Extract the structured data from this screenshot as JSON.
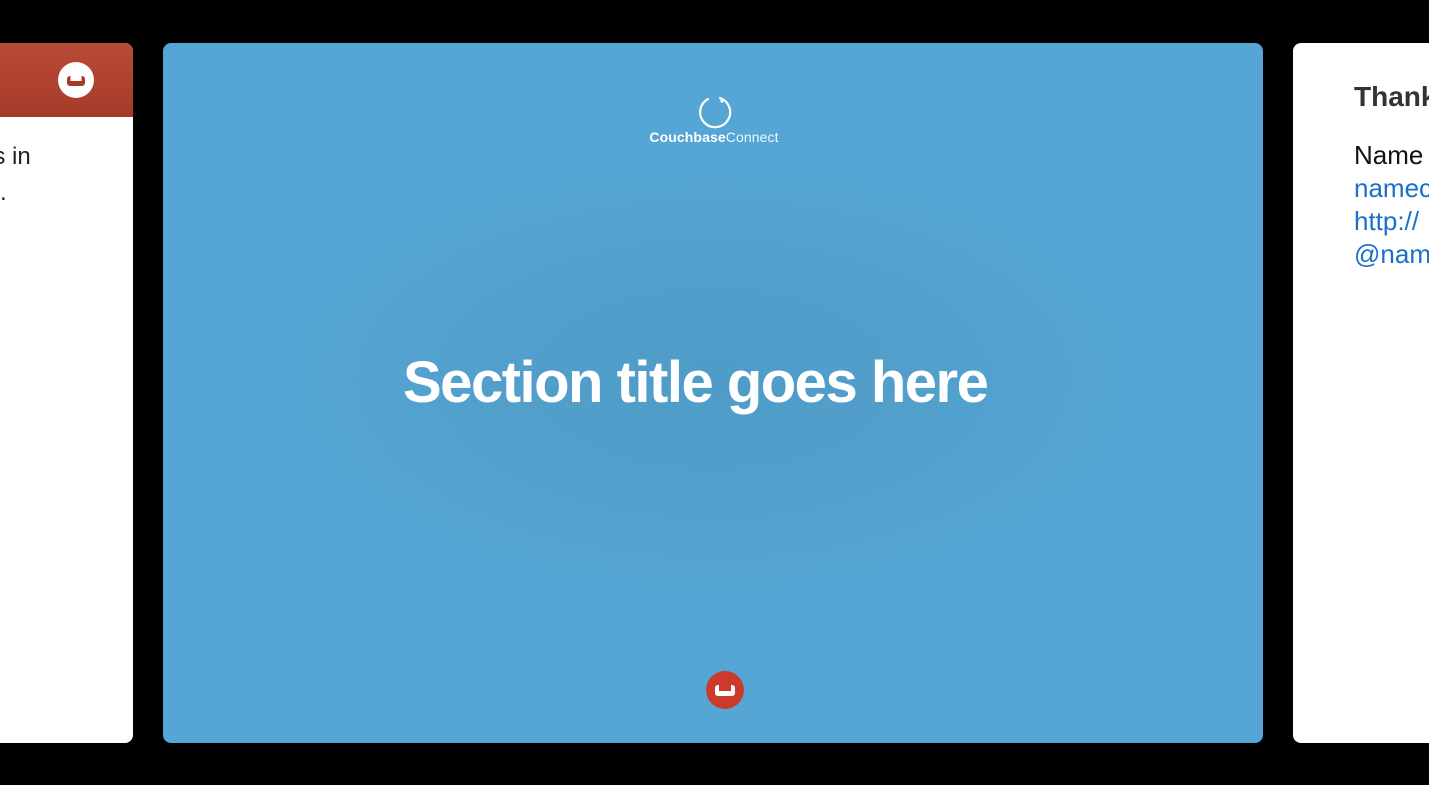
{
  "prev_slide": {
    "text": "us in\nm."
  },
  "current_slide": {
    "brand_bold": "Couchbase",
    "brand_light": "Connect",
    "title": "Section title goes here"
  },
  "next_slide": {
    "title": "Thank",
    "lines": [
      {
        "text": "Name",
        "kind": "plain"
      },
      {
        "text": "namec",
        "kind": "link"
      },
      {
        "text": "http://",
        "kind": "link"
      },
      {
        "text": "@nam",
        "kind": "link"
      }
    ]
  },
  "colors": {
    "background": "#000000",
    "slide_blue": "#55a6d5",
    "couchbase_red": "#cc3a2d",
    "header_red": "#b84a36",
    "link_blue": "#1a6fc9"
  },
  "icons": {
    "prev_logo": "couchbase-logo-icon",
    "brand_ring": "couchbase-connect-ring-icon",
    "footer_logo": "couchbase-logo-icon"
  }
}
